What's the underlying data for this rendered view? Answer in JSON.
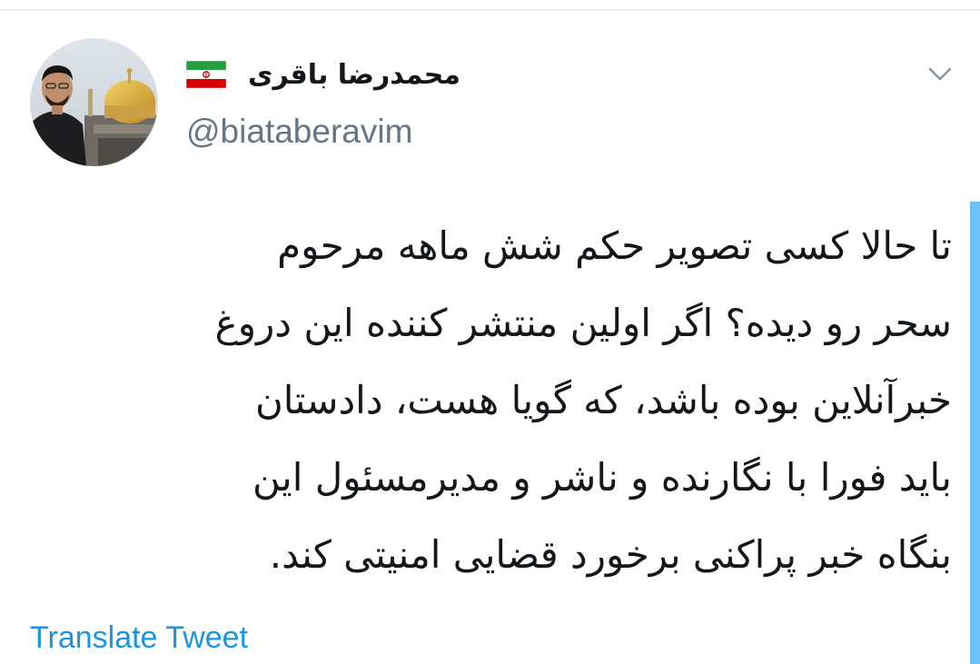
{
  "user": {
    "display_name": "محمدرضا باقری",
    "handle": "@biataberavim",
    "flag_icon": "iran-flag-icon",
    "avatar_icon": "avatar-photo"
  },
  "tweet": {
    "lines": [
      "تا حالا کسی تصویر حکم شش ماهه مرحوم",
      "سحر رو دیده؟ اگر اولین منتشر کننده این دروغ",
      "خبرآنلاین بوده باشد، که گویا هست، دادستان",
      "باید فورا با نگارنده و ناشر و مدیرمسئول این",
      "بنگاه خبر پراکنی برخورد قضایی امنیتی کند."
    ]
  },
  "actions": {
    "translate_label": "Translate Tweet",
    "caret_icon": "chevron-down-icon"
  },
  "colors": {
    "text_primary": "#14171a",
    "text_secondary": "#657786",
    "link": "#1b95e0",
    "accent": "#1da1f2"
  }
}
